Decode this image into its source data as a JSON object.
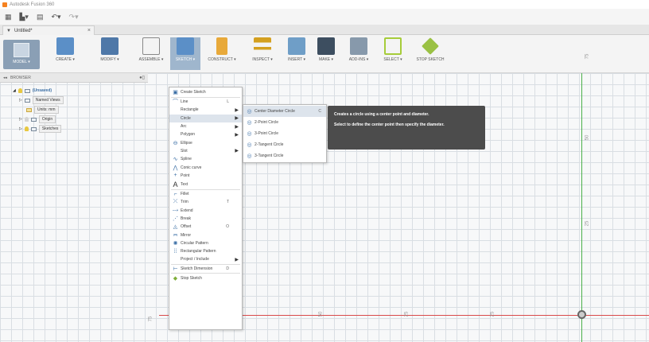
{
  "window": {
    "title": "Autodesk Fusion 360"
  },
  "document_tab": {
    "label": "Untitled*",
    "close": "×"
  },
  "toolbar": {
    "model": "MODEL",
    "create": "CREATE",
    "modify": "MODIFY",
    "assemble": "ASSEMBLE",
    "sketch": "SKETCH",
    "construct": "CONSTRUCT",
    "inspect": "INSPECT",
    "insert": "INSERT",
    "make": "MAKE",
    "addins": "ADD-INS",
    "select": "SELECT",
    "stop_sketch": "STOP SKETCH"
  },
  "browser": {
    "header": "BROWSER",
    "root": "(Unsaved)",
    "named_views": "Named Views",
    "units": "Units: mm",
    "origin": "Origin",
    "sketches": "Sketches"
  },
  "sketch_menu": {
    "create_sketch": "Create Sketch",
    "line": "Line",
    "line_sc": "L",
    "rectangle": "Rectangle",
    "circle": "Circle",
    "arc": "Arc",
    "polygon": "Polygon",
    "ellipse": "Ellipse",
    "slot": "Slot",
    "spline": "Spline",
    "conic_curve": "Conic curve",
    "point": "Point",
    "text": "Text",
    "fillet": "Fillet",
    "trim": "Trim",
    "trim_sc": "T",
    "extend": "Extend",
    "break": "Break",
    "offset": "Offset",
    "offset_sc": "O",
    "mirror": "Mirror",
    "circular_pattern": "Circular Pattern",
    "rectangular_pattern": "Rectangular Pattern",
    "project_include": "Project / Include",
    "sketch_dimension": "Sketch Dimension",
    "sketch_dimension_sc": "D",
    "stop_sketch": "Stop Sketch"
  },
  "circle_submenu": {
    "center_diameter": "Center Diameter Circle",
    "center_diameter_sc": "C",
    "two_point": "2-Point Circle",
    "three_point": "3-Point Circle",
    "two_tangent": "2-Tangent Circle",
    "three_tangent": "3-Tangent Circle"
  },
  "tooltip": {
    "line1": "Creates a circle using a center point and diameter.",
    "line2": "Select to define the center point then specify the diameter."
  },
  "axis_ticks": [
    "25",
    "50",
    "75",
    "25",
    "50",
    "75"
  ],
  "colors": {
    "x_axis": "#d94a4a",
    "y_axis": "#4ab04a",
    "active_tab": "#8a9fb5"
  }
}
